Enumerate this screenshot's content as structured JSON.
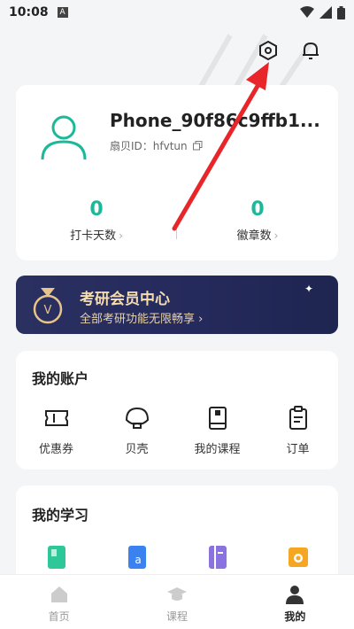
{
  "status_bar": {
    "time": "10:08",
    "a_badge": "A"
  },
  "header": {
    "settings_icon": "settings-hex-icon",
    "bell_icon": "bell-icon"
  },
  "profile": {
    "username": "Phone_90f86c9ffb1...",
    "id_label": "扇贝ID：hfvtun",
    "stats": [
      {
        "value": "0",
        "label": "打卡天数"
      },
      {
        "value": "0",
        "label": "徽章数"
      }
    ]
  },
  "banner": {
    "title": "考研会员中心",
    "subtitle": "全部考研功能无限畅享"
  },
  "account": {
    "title": "我的账户",
    "items": [
      {
        "label": "优惠券",
        "icon": "coupon-icon"
      },
      {
        "label": "贝壳",
        "icon": "shell-icon"
      },
      {
        "label": "我的课程",
        "icon": "book-icon"
      },
      {
        "label": "订单",
        "icon": "clipboard-icon"
      }
    ]
  },
  "learning": {
    "title": "我的学习"
  },
  "nav": [
    {
      "label": "首页",
      "icon": "home-icon"
    },
    {
      "label": "课程",
      "icon": "grad-cap-icon"
    },
    {
      "label": "我的",
      "icon": "person-icon"
    }
  ],
  "colors": {
    "accent": "#1bb99a",
    "banner_bg": "#252a5c",
    "arrow": "#e8262a"
  }
}
